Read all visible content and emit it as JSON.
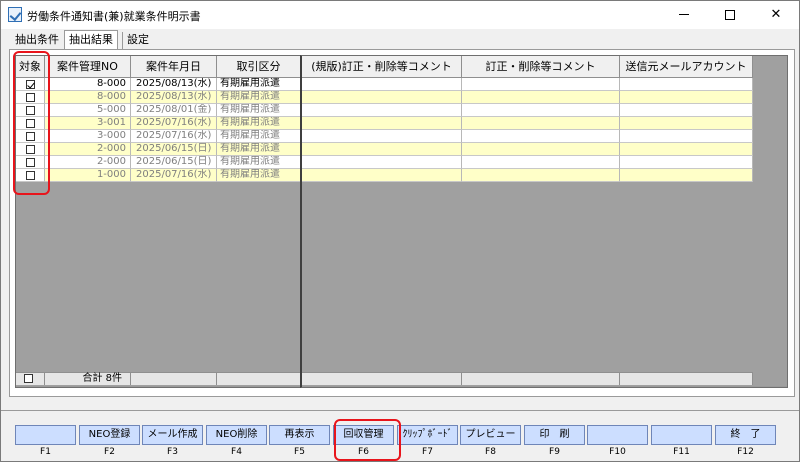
{
  "window": {
    "title": "労働条件通知書(兼)就業条件明示書",
    "minimize_label": "",
    "maximize_label": "",
    "close_label": "✕"
  },
  "tabs": [
    {
      "label": "抽出条件"
    },
    {
      "label": "抽出結果"
    },
    {
      "label": "設定"
    }
  ],
  "grid": {
    "headers": [
      "対象",
      "案件管理NO",
      "案件年月日",
      "取引区分"
    ],
    "right_headers": [
      "(規版)訂正・削除等コメント",
      "訂正・削除等コメント",
      "送信元メールアカウント"
    ],
    "rows": [
      {
        "checked": true,
        "no": "8-000",
        "date": "2025/08/13(水)",
        "type": "有期雇用派遣",
        "style": "first"
      },
      {
        "checked": false,
        "no": "8-000",
        "date": "2025/08/13(水)",
        "type": "有期雇用派遣",
        "style": "yellow"
      },
      {
        "checked": false,
        "no": "5-000",
        "date": "2025/08/01(金)",
        "type": "有期雇用派遣",
        "style": "white"
      },
      {
        "checked": false,
        "no": "3-001",
        "date": "2025/07/16(水)",
        "type": "有期雇用派遣",
        "style": "yellow"
      },
      {
        "checked": false,
        "no": "3-000",
        "date": "2025/07/16(水)",
        "type": "有期雇用派遣",
        "style": "white"
      },
      {
        "checked": false,
        "no": "2-000",
        "date": "2025/06/15(日)",
        "type": "有期雇用派遣",
        "style": "yellow"
      },
      {
        "checked": false,
        "no": "2-000",
        "date": "2025/06/15(日)",
        "type": "有期雇用派遣",
        "style": "white"
      },
      {
        "checked": false,
        "no": "1-000",
        "date": "2025/07/16(水)",
        "type": "有期雇用派遣",
        "style": "yellow"
      }
    ],
    "total_label": "合計 8件"
  },
  "scroll": {
    "left_arrow": "◀",
    "right_arrow": "▶",
    "left_arrow_small": "‹"
  },
  "fkeys": [
    {
      "key": "F1",
      "label": ""
    },
    {
      "key": "F2",
      "label": "NEO登録"
    },
    {
      "key": "F3",
      "label": "メール作成"
    },
    {
      "key": "F4",
      "label": "NEO削除"
    },
    {
      "key": "F5",
      "label": "再表示"
    },
    {
      "key": "F6",
      "label": "回収管理"
    },
    {
      "key": "F7",
      "label": "ｸﾘｯﾌﾟﾎﾞｰﾄﾞ"
    },
    {
      "key": "F8",
      "label": "プレビュー"
    },
    {
      "key": "F9",
      "label": "印　刷"
    },
    {
      "key": "F10",
      "label": ""
    },
    {
      "key": "F11",
      "label": ""
    },
    {
      "key": "F12",
      "label": "終　了"
    }
  ],
  "colors": {
    "row_yellow": "#ffffc8",
    "fkey_bg": "#ccdeff",
    "highlight": "#e8141b"
  }
}
